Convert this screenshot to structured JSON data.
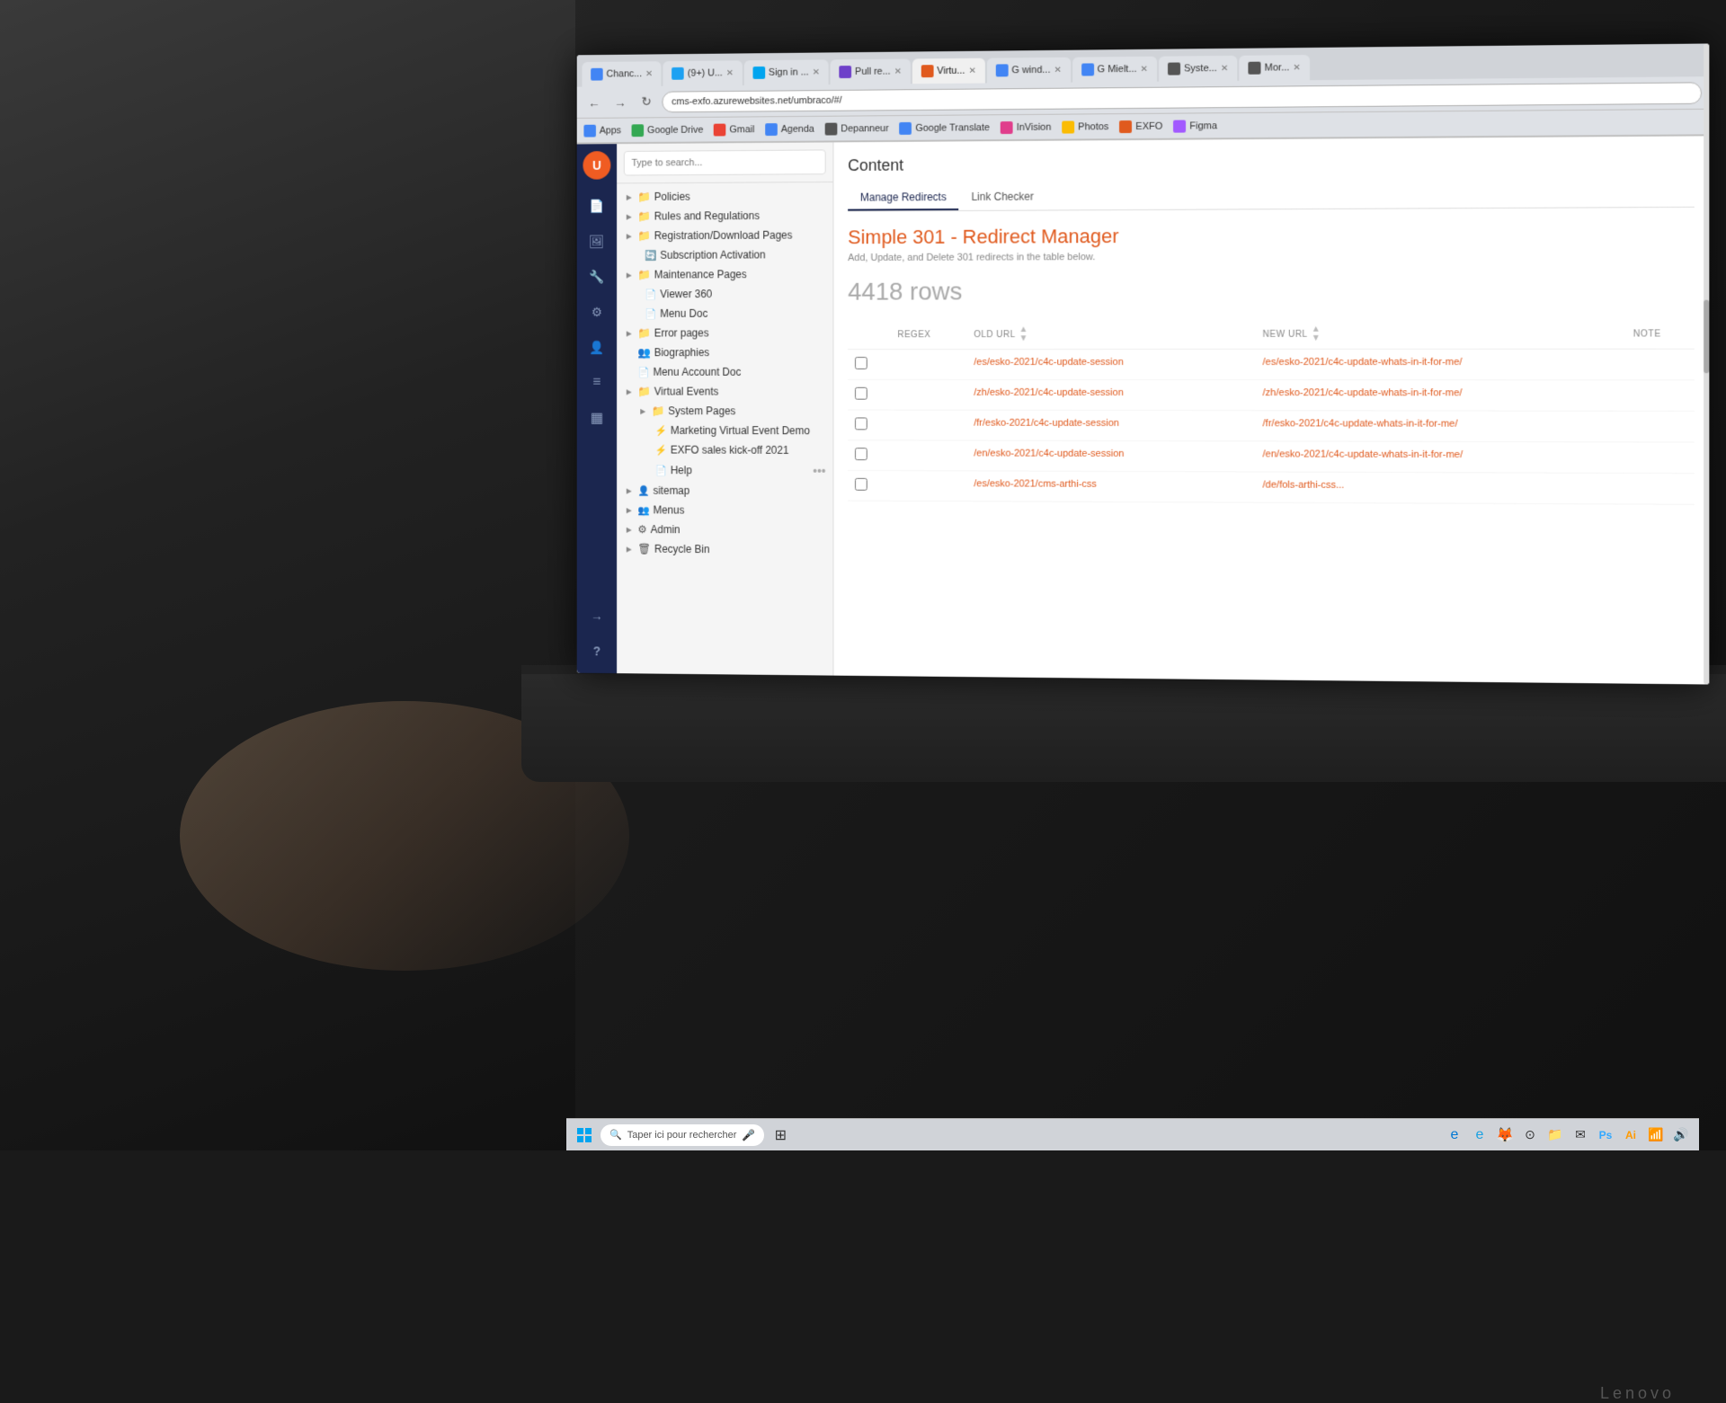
{
  "browser": {
    "address": "cms-exfo.azurewebsites.net/umbraco/#/",
    "tabs": [
      {
        "label": "Chanc...",
        "favicon_color": "#4285f4",
        "active": false
      },
      {
        "label": "(9+) U...",
        "favicon_color": "#1da1f2",
        "active": false
      },
      {
        "label": "Sign in ...",
        "favicon_color": "#00a4ef",
        "active": false
      },
      {
        "label": "Pull re...",
        "favicon_color": "#6e40c9",
        "active": false
      },
      {
        "label": "Virtu...",
        "favicon_color": "#e05a1e",
        "active": true
      },
      {
        "label": "G wind...",
        "favicon_color": "#4285f4",
        "active": false
      },
      {
        "label": "G Mielt...",
        "favicon_color": "#4285f4",
        "active": false
      },
      {
        "label": "Syste...",
        "favicon_color": "#555",
        "active": false
      },
      {
        "label": "Mor...",
        "favicon_color": "#555",
        "active": false
      }
    ],
    "bookmarks": [
      {
        "label": "Apps",
        "icon_color": "#4285f4"
      },
      {
        "label": "Google Drive",
        "icon_color": "#34a853"
      },
      {
        "label": "Gmail",
        "icon_color": "#ea4335"
      },
      {
        "label": "Agenda",
        "icon_color": "#4285f4"
      },
      {
        "label": "Depanneur",
        "icon_color": "#555"
      },
      {
        "label": "Google Translate",
        "icon_color": "#4285f4"
      },
      {
        "label": "InVision",
        "icon_color": "#e03e8c"
      },
      {
        "label": "Photos",
        "icon_color": "#fbbc04"
      },
      {
        "label": "EXFO",
        "icon_color": "#e05a1e"
      },
      {
        "label": "Figma",
        "icon_color": "#a259ff"
      }
    ]
  },
  "search": {
    "placeholder": "Type to search..."
  },
  "tree": {
    "items": [
      {
        "label": "Policies",
        "type": "folder",
        "indent": 0
      },
      {
        "label": "Rules and Regulations",
        "type": "folder",
        "indent": 0
      },
      {
        "label": "Registration/Download Pages",
        "type": "folder",
        "indent": 0
      },
      {
        "label": "Subscription Activation",
        "type": "doc",
        "indent": 1
      },
      {
        "label": "Maintenance Pages",
        "type": "folder",
        "indent": 0
      },
      {
        "label": "Viewer 360",
        "type": "doc",
        "indent": 1
      },
      {
        "label": "Menu Doc",
        "type": "doc",
        "indent": 1
      },
      {
        "label": "Error pages",
        "type": "folder",
        "indent": 0
      },
      {
        "label": "Biographies",
        "type": "folder_special",
        "indent": 0
      },
      {
        "label": "Menu Account Doc",
        "type": "doc",
        "indent": 0
      },
      {
        "label": "Virtual Events",
        "type": "folder",
        "indent": 0
      },
      {
        "label": "System Pages",
        "type": "folder",
        "indent": 1
      },
      {
        "label": "Marketing Virtual Event Demo",
        "type": "special",
        "indent": 2
      },
      {
        "label": "EXFO sales kick-off 2021",
        "type": "special",
        "indent": 2
      },
      {
        "label": "Help",
        "type": "doc",
        "indent": 2
      },
      {
        "label": "sitemap",
        "type": "doc_special",
        "indent": 0
      },
      {
        "label": "Menus",
        "type": "folder",
        "indent": 0
      },
      {
        "label": "Admin",
        "type": "folder",
        "indent": 0
      },
      {
        "label": "Recycle Bin",
        "type": "folder",
        "indent": 0
      }
    ]
  },
  "content": {
    "title": "Content",
    "tabs": [
      {
        "label": "Manage Redirects",
        "active": true
      },
      {
        "label": "Link Checker",
        "active": false
      }
    ],
    "redirect_title": "Simple 301 - Redirect Manager",
    "redirect_subtitle": "Add, Update, and Delete 301 redirects in the table below.",
    "rows_count": "4418 rows",
    "table": {
      "columns": [
        "REGEX",
        "OLD URL",
        "",
        "NEW URL",
        "",
        "NOTE"
      ],
      "rows": [
        {
          "checked": false,
          "old_url": "/es/esko-2021/c4c-update-session",
          "new_url": "/es/esko-2021/c4c-update-whats-in-it-for-me/"
        },
        {
          "checked": false,
          "old_url": "/zh/esko-2021/c4c-update-session",
          "new_url": "/zh/esko-2021/c4c-update-whats-in-it-for-me/"
        },
        {
          "checked": false,
          "old_url": "/fr/esko-2021/c4c-update-session",
          "new_url": "/fr/esko-2021/c4c-update-whats-in-it-for-me/"
        },
        {
          "checked": false,
          "old_url": "/en/esko-2021/c4c-update-session",
          "new_url": "/en/esko-2021/c4c-update-whats-in-it-for-me/"
        },
        {
          "checked": false,
          "old_url": "/es/esko-2021/cms-arthi-css",
          "new_url": "/de/fols-arthi-css..."
        }
      ]
    }
  },
  "taskbar": {
    "search_placeholder": "Taper ici pour rechercher",
    "brand": "Lenovo"
  },
  "sidebar": {
    "icons": [
      {
        "name": "document-icon",
        "symbol": "📄"
      },
      {
        "name": "image-icon",
        "symbol": "🖼"
      },
      {
        "name": "wrench-icon",
        "symbol": "🔧"
      },
      {
        "name": "settings-icon",
        "symbol": "⚙"
      },
      {
        "name": "user-icon",
        "symbol": "👤"
      },
      {
        "name": "list-icon",
        "symbol": "☰"
      },
      {
        "name": "grid-icon",
        "symbol": "▦"
      },
      {
        "name": "arrow-icon",
        "symbol": "→"
      },
      {
        "name": "help-icon",
        "symbol": "?"
      }
    ]
  }
}
